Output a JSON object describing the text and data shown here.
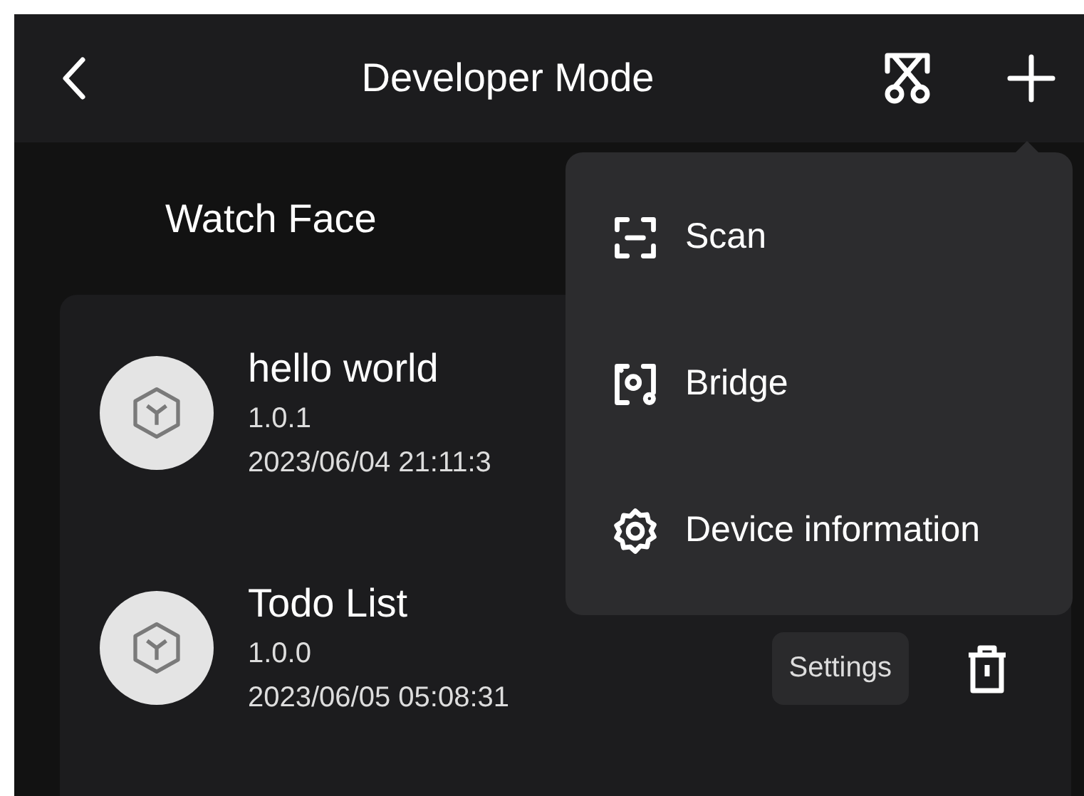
{
  "header": {
    "title": "Developer Mode"
  },
  "tabs": [
    {
      "label": "Watch Face",
      "selected": true
    }
  ],
  "apps": [
    {
      "name": "hello world",
      "version": "1.0.1",
      "date": "2023/06/04 21:11:3"
    },
    {
      "name": "Todo List",
      "version": "1.0.0",
      "date": "2023/06/05 05:08:31",
      "settings_label": "Settings"
    }
  ],
  "menu": {
    "items": [
      {
        "kind": "scan",
        "label": "Scan"
      },
      {
        "kind": "bridge",
        "label": "Bridge"
      },
      {
        "kind": "device",
        "label": "Device information"
      }
    ]
  }
}
